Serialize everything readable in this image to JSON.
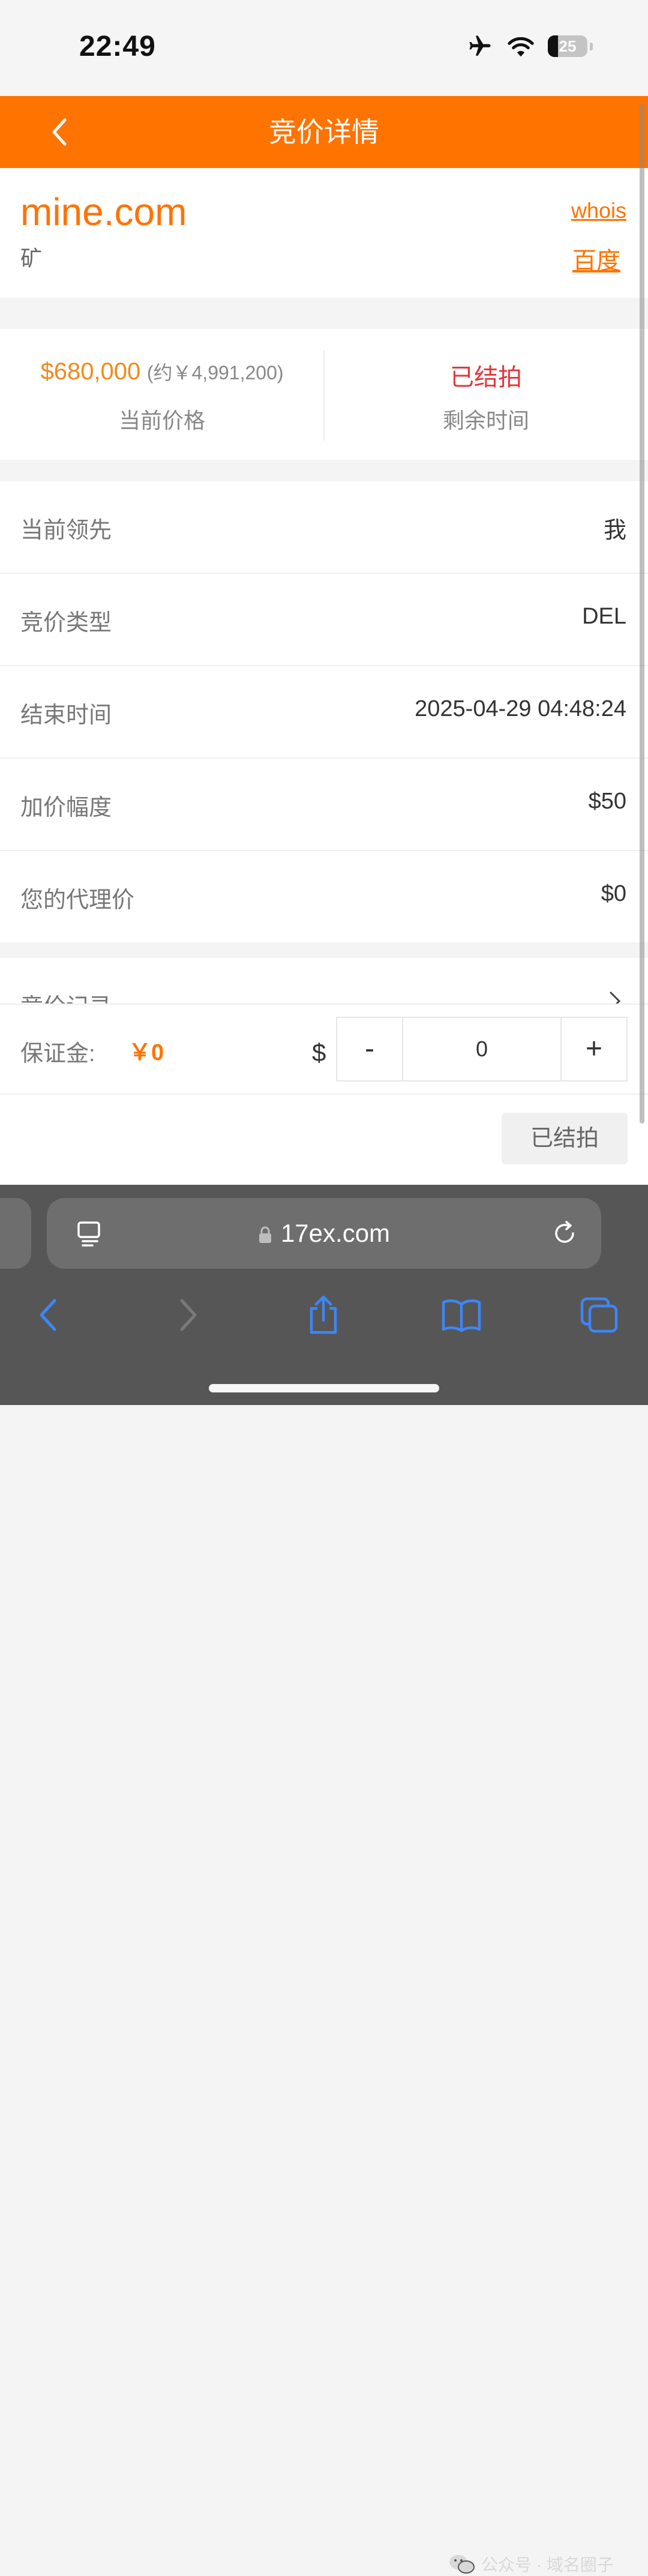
{
  "status_bar": {
    "time": "22:49",
    "battery_level": "25",
    "battery_fraction": 0.25
  },
  "nav": {
    "title": "竞价详情"
  },
  "domain": {
    "name": "mine.com",
    "meaning": "矿",
    "whois_label": "whois",
    "baidu_label": "百度"
  },
  "price": {
    "current_usd": "$680,000",
    "current_cny": "(约￥4,991,200)",
    "current_label": "当前价格",
    "remaining_status": "已结拍",
    "remaining_label": "剩余时间"
  },
  "details": [
    {
      "label": "当前领先",
      "value": "我"
    },
    {
      "label": "竞价类型",
      "value": "DEL"
    },
    {
      "label": "结束时间",
      "value": "2025-04-29 04:48:24"
    },
    {
      "label": "加价幅度",
      "value": "$50"
    },
    {
      "label": "您的代理价",
      "value": "$0"
    }
  ],
  "records": {
    "label": "竞价记录"
  },
  "bid": {
    "deposit_label": "保证金:",
    "deposit_value": "￥0",
    "currency": "$",
    "minus": "-",
    "plus": "+",
    "amount": "0"
  },
  "action": {
    "button_label": "已结拍"
  },
  "browser": {
    "url": "17ex.com"
  },
  "watermark": {
    "text": "公众号 · 域名圈子"
  },
  "colors": {
    "accent": "#ff7300",
    "ended_red": "#e0383e",
    "safari_blue": "#3d86f7"
  }
}
